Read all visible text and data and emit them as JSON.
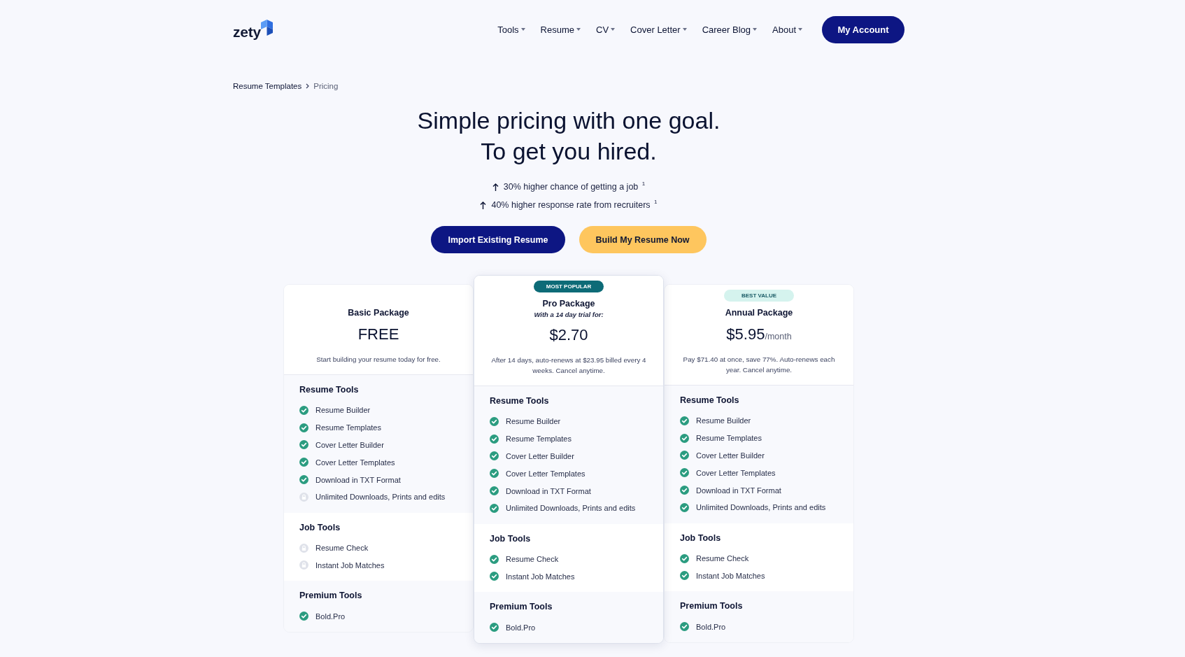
{
  "header": {
    "logo": {
      "text": "zety"
    },
    "nav": [
      {
        "label": "Tools"
      },
      {
        "label": "Resume"
      },
      {
        "label": "CV"
      },
      {
        "label": "Cover Letter"
      },
      {
        "label": "Career Blog"
      },
      {
        "label": "About"
      }
    ],
    "account_button": "My Account"
  },
  "breadcrumb": [
    {
      "label": "Resume Templates",
      "current": false
    },
    {
      "label": "Pricing",
      "current": true
    }
  ],
  "hero": {
    "title_lines": [
      "Simple pricing with one goal.",
      "To get you hired."
    ],
    "stats": [
      "30% higher chance of getting a job $^{1}$",
      "40% higher response rate from recruiters $^{1}$"
    ],
    "buttons": [
      {
        "label": "Import Existing Resume",
        "kind": "primary"
      },
      {
        "label": "Build My Resume Now",
        "kind": "accent"
      }
    ]
  },
  "plans": [
    {
      "name": "Basic Package",
      "featured": false,
      "price": "FREE",
      "description": "Start building your resume today for free.",
      "sections": [
        {
          "title": "Resume Tools",
          "features": [
            {
              "label": "Resume Builder",
              "included": true
            },
            {
              "label": "Resume Templates",
              "included": true
            },
            {
              "label": "Cover Letter Builder",
              "included": true
            },
            {
              "label": "Cover Letter Templates",
              "included": true
            },
            {
              "label": "Download in TXT Format",
              "included": true
            },
            {
              "label": "Unlimited Downloads, Prints and edits",
              "included": false
            }
          ]
        },
        {
          "title": "Job Tools",
          "features": [
            {
              "label": "Resume Check",
              "included": false
            },
            {
              "label": "Instant Job Matches",
              "included": false
            }
          ]
        },
        {
          "title": "Premium Tools",
          "features": [
            {
              "label": "Bold.Pro",
              "included": true
            }
          ]
        }
      ]
    },
    {
      "name": "Pro Package",
      "featured": true,
      "badge": {
        "text": "MOST POPULAR",
        "kind": "dark"
      },
      "trial_note": "With a 14 day trial for:",
      "price": "$2.70",
      "description": "After 14 days, auto-renews at $23.95 billed every 4 weeks. Cancel anytime.",
      "sections": [
        {
          "title": "Resume Tools",
          "features": [
            {
              "label": "Resume Builder",
              "included": true
            },
            {
              "label": "Resume Templates",
              "included": true
            },
            {
              "label": "Cover Letter Builder",
              "included": true
            },
            {
              "label": "Cover Letter Templates",
              "included": true
            },
            {
              "label": "Download in TXT Format",
              "included": true
            },
            {
              "label": "Unlimited Downloads, Prints and edits",
              "included": true
            }
          ]
        },
        {
          "title": "Job Tools",
          "features": [
            {
              "label": "Resume Check",
              "included": true
            },
            {
              "label": "Instant Job Matches",
              "included": true
            }
          ]
        },
        {
          "title": "Premium Tools",
          "features": [
            {
              "label": "Bold.Pro",
              "included": true
            }
          ]
        }
      ]
    },
    {
      "name": "Annual Package",
      "featured": false,
      "badge": {
        "text": "BEST VALUE",
        "kind": "light"
      },
      "price": "$5.95",
      "price_period": "/month",
      "description": "Pay $71.40 at once, save 77%. Auto-renews each year. Cancel anytime.",
      "sections": [
        {
          "title": "Resume Tools",
          "features": [
            {
              "label": "Resume Builder",
              "included": true
            },
            {
              "label": "Resume Templates",
              "included": true
            },
            {
              "label": "Cover Letter Builder",
              "included": true
            },
            {
              "label": "Cover Letter Templates",
              "included": true
            },
            {
              "label": "Download in TXT Format",
              "included": true
            },
            {
              "label": "Unlimited Downloads, Prints and edits",
              "included": true
            }
          ]
        },
        {
          "title": "Job Tools",
          "features": [
            {
              "label": "Resume Check",
              "included": true
            },
            {
              "label": "Instant Job Matches",
              "included": true
            }
          ]
        },
        {
          "title": "Premium Tools",
          "features": [
            {
              "label": "Bold.Pro",
              "included": true
            }
          ]
        }
      ]
    }
  ]
}
